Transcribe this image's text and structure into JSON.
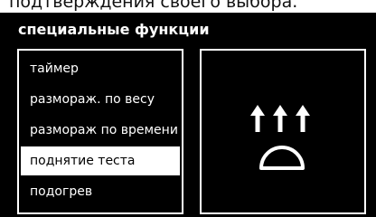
{
  "header": {
    "text": "подтверждения своего выбора."
  },
  "screen": {
    "title": "специальные функции",
    "menu": {
      "items": [
        {
          "label": "таймер",
          "selected": false
        },
        {
          "label": "размораж. по весу",
          "selected": false
        },
        {
          "label": "размораж по времени",
          "selected": false
        },
        {
          "label": "поднятие теста",
          "selected": true
        },
        {
          "label": "подогрев",
          "selected": false
        }
      ]
    },
    "preview": {
      "icon": "dough-rise-icon"
    }
  },
  "colors": {
    "background": "#000000",
    "foreground": "#ffffff",
    "selected_bg": "#ffffff",
    "selected_fg": "#000000"
  }
}
